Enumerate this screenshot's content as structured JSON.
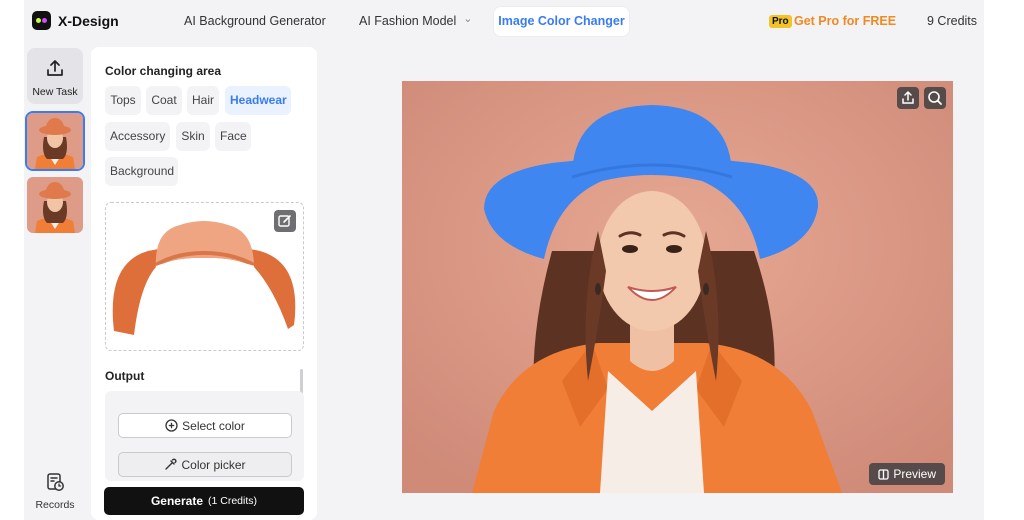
{
  "app": {
    "name": "X-Design"
  },
  "nav": {
    "items": [
      {
        "label": "AI Background Generator"
      },
      {
        "label": "AI Fashion Model"
      },
      {
        "label": "Image Color Changer"
      }
    ],
    "pro_badge": "Pro",
    "pro_label": "Get Pro for FREE",
    "credits": "9 Credits"
  },
  "rail": {
    "new_task": "New Task",
    "records": "Records"
  },
  "panel": {
    "area_title": "Color changing area",
    "chips": [
      "Tops",
      "Coat",
      "Hair",
      "Headwear",
      "Accessory",
      "Skin",
      "Face",
      "Background"
    ],
    "selected_chip": "Headwear",
    "output_title": "Output",
    "select_color": "Select color",
    "color_picker": "Color picker",
    "generate": "Generate",
    "generate_cost": "(1 Credits)"
  },
  "canvas": {
    "preview": "Preview"
  },
  "colors": {
    "accent": "#3a7cf0",
    "pro": "#ef8a22",
    "new_hat": "#3f86f0",
    "original_hat": "#e07a4c",
    "backdrop": "#de9c88",
    "jacket": "#f07e36"
  }
}
